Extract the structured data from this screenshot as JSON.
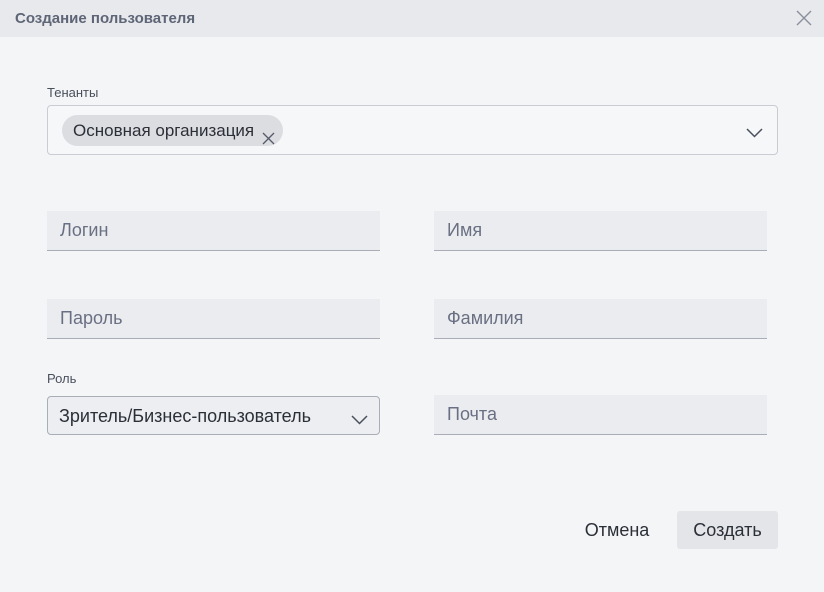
{
  "dialog": {
    "title": "Создание пользователя",
    "close_icon": "close-icon"
  },
  "tenants": {
    "label": "Тенанты",
    "selected": [
      "Основная организация"
    ],
    "remove_icon": "close-icon",
    "dropdown_icon": "chevron-down-icon"
  },
  "fields": {
    "login_placeholder": "Логин",
    "first_name_placeholder": "Имя",
    "password_placeholder": "Пароль",
    "last_name_placeholder": "Фамилия",
    "email_placeholder": "Почта"
  },
  "role": {
    "label": "Роль",
    "value": "Зритель/Бизнес-пользователь",
    "dropdown_icon": "chevron-down-icon"
  },
  "actions": {
    "cancel_label": "Отмена",
    "create_label": "Создать"
  }
}
